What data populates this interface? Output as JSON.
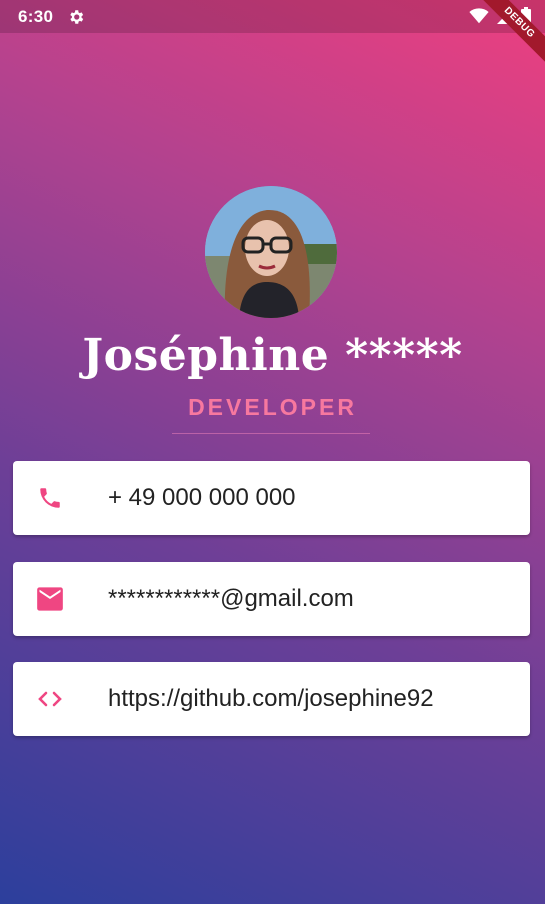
{
  "status_bar": {
    "time": "6:30",
    "icons": [
      "gear-icon",
      "wifi-icon",
      "signal-icon",
      "battery-icon"
    ]
  },
  "debug_banner": {
    "label": "DEBUG"
  },
  "profile": {
    "name": "Joséphine *****",
    "role": "DEVELOPER"
  },
  "contacts": [
    {
      "icon": "phone-icon",
      "value": "+ 49 000 000 000"
    },
    {
      "icon": "email-icon",
      "value": "************@gmail.com"
    },
    {
      "icon": "code-icon",
      "value": "https://github.com/josephine92"
    }
  ],
  "colors": {
    "accent": "#ef4682",
    "role": "#f7789f",
    "gradient_top": "#ee3f7f",
    "gradient_bottom": "#2c3f9c"
  }
}
